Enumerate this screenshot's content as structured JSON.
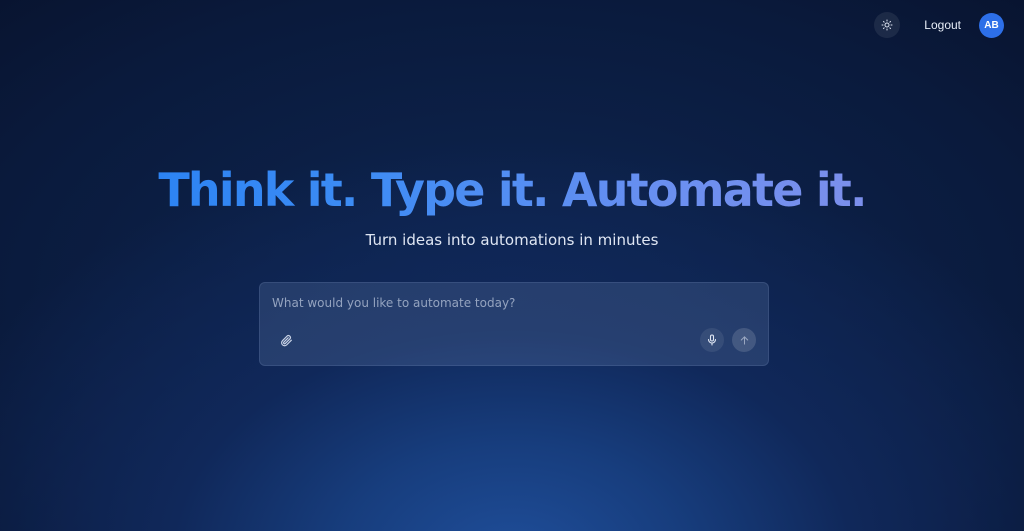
{
  "header": {
    "theme_toggle_icon": "sun-icon",
    "logout_label": "Logout",
    "avatar_initials": "AB"
  },
  "hero": {
    "title": "Think it. Type it. Automate it.",
    "subtitle": "Turn ideas into automations in minutes"
  },
  "prompt": {
    "placeholder": "What would you like to automate today?",
    "value": "",
    "attach_icon": "paperclip-icon",
    "mic_icon": "microphone-icon",
    "send_icon": "arrow-up-icon"
  },
  "colors": {
    "background_dark": "#070f26",
    "background_glow": "#1f4e9a",
    "title_gradient_start": "#1f7cf2",
    "title_gradient_end": "#8a8fe8",
    "avatar_bg": "#2d6fe8"
  }
}
